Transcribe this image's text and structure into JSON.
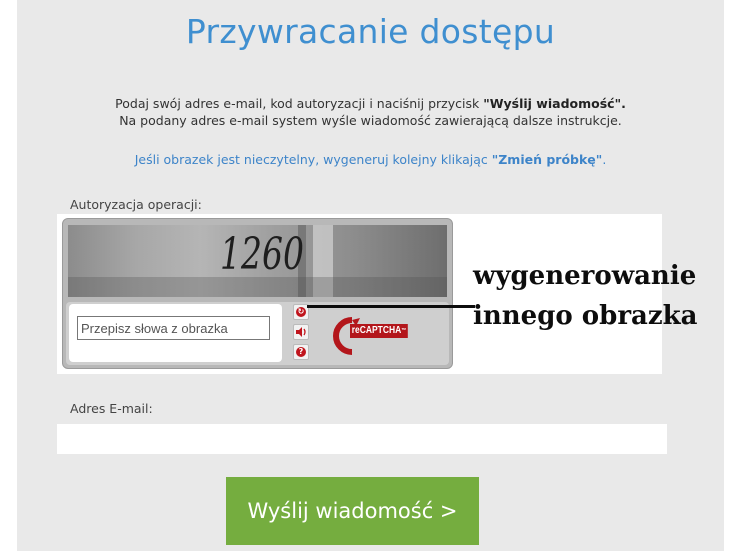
{
  "page": {
    "title": "Przywracanie dostępu",
    "intro_line1_pre": "Podaj swój adres e-mail, kod autoryzacji i naciśnij przycisk ",
    "intro_line1_bold": "\"Wyślij wiadomość\".",
    "intro_line2": "Na podany adres e-mail system wyśle wiadomość zawierającą dalsze instrukcje.",
    "hint_pre": "Jeśli obrazek jest nieczytelny, wygeneruj kolejny klikając ",
    "hint_bold": "\"Zmień próbkę\"",
    "hint_post": "."
  },
  "captcha": {
    "label": "Autoryzacja operacji:",
    "image_text": "1260",
    "input_placeholder": "Przepisz słowa z obrazka",
    "logo_text": "CAPTCHA",
    "logo_prefix": "re",
    "logo_tm": "™",
    "icons": [
      "refresh-icon",
      "audio-icon",
      "help-icon"
    ]
  },
  "annotation": {
    "line1": "wygenerowanie",
    "line2": "innego obrazka"
  },
  "email": {
    "label": "Adres E-mail:",
    "value": ""
  },
  "submit": {
    "label": "Wyślij wiadomość >"
  },
  "colors": {
    "title": "#3f8fd0",
    "hint": "#3d84c9",
    "button": "#75ad3f",
    "recaptcha_red": "#b3161b"
  }
}
